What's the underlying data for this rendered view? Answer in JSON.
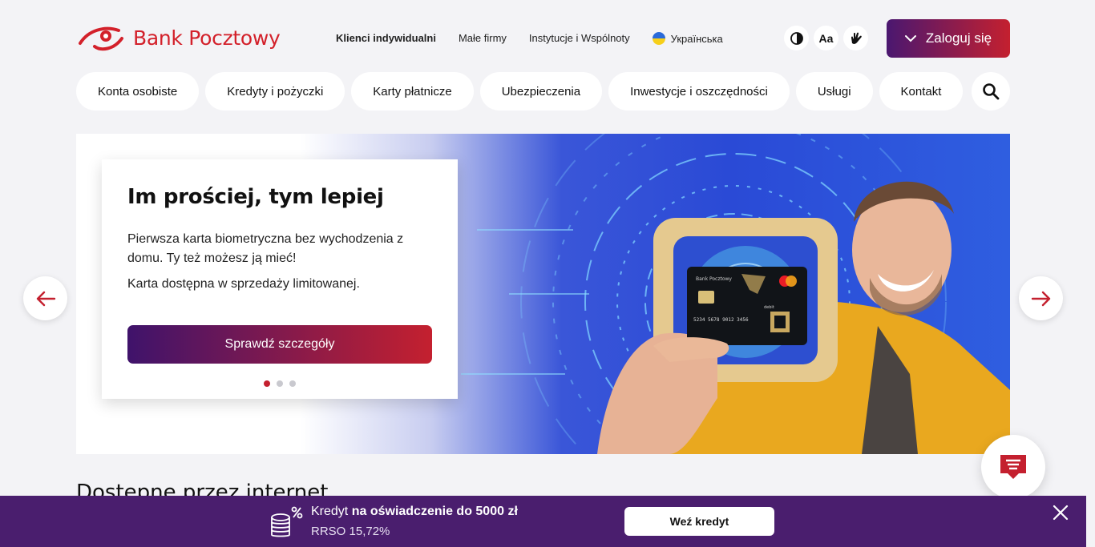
{
  "header": {
    "brand": "Bank Pocztowy",
    "topnav": [
      "Klienci indywidualni",
      "Małe firmy",
      "Instytucje i Wspólnoty"
    ],
    "language": "Українська",
    "font_size_label": "Aa",
    "login_label": "Zaloguj się"
  },
  "mainnav": [
    "Konta osobiste",
    "Kredyty i pożyczki",
    "Karty płatnicze",
    "Ubezpieczenia",
    "Inwestycje i oszczędności",
    "Usługi",
    "Kontakt"
  ],
  "hero": {
    "title": "Im prościej, tym lepiej",
    "text1": "Pierwsza karta biometryczna bez wychodzenia z domu. Ty też możesz ją mieć!",
    "text2": "Karta dostępna w sprzedaży limitowanej.",
    "cta": "Sprawdź szczegóły",
    "card_brand": "Bank Pocztowy",
    "card_number": "5234 5678 9012 3456",
    "card_type": "debit",
    "slides": 3,
    "active_slide": 1
  },
  "section_title": "Dostępne przez internet",
  "promo": {
    "text_prefix": "Kredyt",
    "text_bold": "na oświadczenie do 5000 zł",
    "rrso": "RRSO 15,72%",
    "button": "Weź kredyt"
  },
  "colors": {
    "brand_red": "#d3202a",
    "gradient_start": "#4a1770",
    "gradient_end": "#c4202f",
    "promo_bg": "#4a1e6e"
  }
}
